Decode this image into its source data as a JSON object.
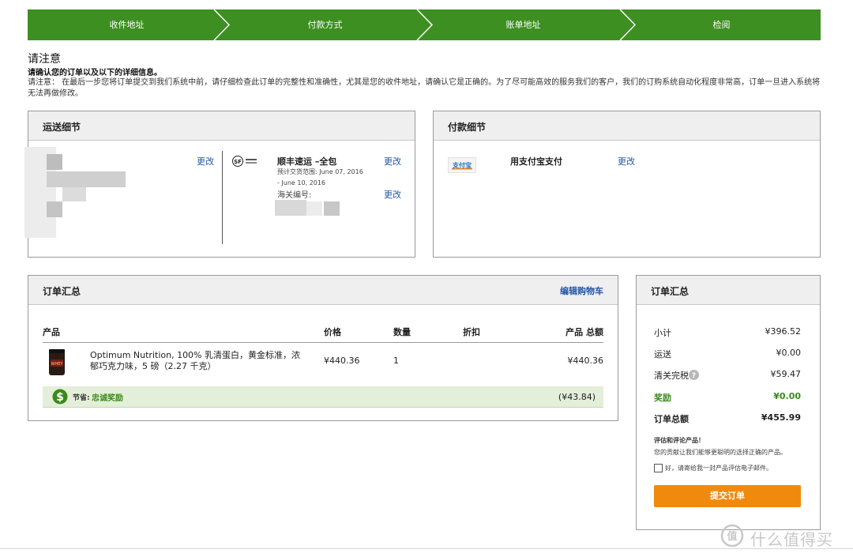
{
  "steps": [
    "收件地址",
    "付款方式",
    "账单地址",
    "检阅"
  ],
  "notice": {
    "title": "请注意",
    "bold": "请确认您的订单以及以下的详细信息。",
    "text": "请注意： 在最后一步您将订单提交到我们系统中前，请仔细检查此订单的完整性和准确性，尤其是您的收件地址，请确认它是正确的。为了尽可能高效的服务我们的客户，我们的订购系统自动化程度非常高，订单一旦进入系统将无法再做修改。"
  },
  "shipping": {
    "title": "运送细节",
    "address_edit": "更改",
    "method_name": "顺丰速运 –全包",
    "eta_line1": "预计交货范围: June 07, 2016",
    "eta_line2": "- June 10, 2016",
    "tracking_label": "海关编号:",
    "method_edit": "更改",
    "tracking_edit": "更改",
    "carrier_logo_text": "SF顺丰速运",
    "carrier_logo_icon": "sf-express-logo"
  },
  "payment": {
    "title": "付款细节",
    "method": "用支付宝支付",
    "edit": "更改",
    "logo_text": "支付宝",
    "logo_icon": "alipay-logo"
  },
  "order": {
    "title": "订单汇总",
    "edit_cart": "编辑购物车",
    "headers": {
      "product": "产品",
      "price": "价格",
      "qty": "数量",
      "discount": "折扣",
      "total": "产品 总额"
    },
    "item": {
      "name": "Optimum Nutrition, 100% 乳清蛋白，黄金标准，浓郁巧克力味，5 磅（2.27 千克）",
      "price": "¥440.36",
      "qty": "1",
      "total": "¥440.36",
      "image_icon": "whey-protein-jar"
    },
    "savings": {
      "label": "节省:",
      "name": "忠诚奖励",
      "amount": "(¥43.84)",
      "icon": "dollar-circle-icon"
    }
  },
  "summary": {
    "title": "订单汇总",
    "rows": [
      {
        "label": "小计",
        "value": "¥396.52"
      },
      {
        "label": "运送",
        "value": "¥0.00"
      },
      {
        "label": "清关完税",
        "value": "¥59.47"
      },
      {
        "label": "奖励",
        "value": "¥0.00"
      },
      {
        "label": "订单总额",
        "value": "¥455.99"
      }
    ],
    "review_title": "评估和评论产品！",
    "review_text": "您的贡献让我们能够更聪明的选择正确的产品。",
    "checkbox_label": "好，请寄给我一封产品评估电子邮件。",
    "submit": "提交订单"
  },
  "watermark": {
    "text": "什么值得买",
    "icon": "smzdm-logo-icon"
  },
  "colors": {
    "step_green": "#3c8f20",
    "link_blue": "#2257a6",
    "submit_orange": "#f08a0c",
    "reward_green": "#3a8a1c",
    "savings_bg": "#e4efd9"
  }
}
